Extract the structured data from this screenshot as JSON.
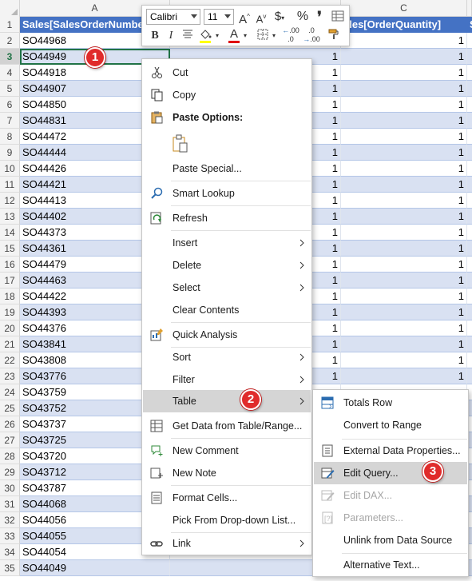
{
  "columns": {
    "a": "A",
    "c": "C"
  },
  "table_header": {
    "col_a": "Sales[SalesOrderNumbe",
    "col_c": "ales[OrderQuantity]",
    "col_d": "S"
  },
  "rows": [
    {
      "n": "1"
    },
    {
      "n": "2",
      "order": "SO44968",
      "b": "",
      "c": "1"
    },
    {
      "n": "3",
      "order": "SO44949",
      "b": "1",
      "c": "1"
    },
    {
      "n": "4",
      "order": "SO44918",
      "b": "1",
      "c": "1"
    },
    {
      "n": "5",
      "order": "SO44907",
      "b": "1",
      "c": "1"
    },
    {
      "n": "6",
      "order": "SO44850",
      "b": "1",
      "c": "1"
    },
    {
      "n": "7",
      "order": "SO44831",
      "b": "1",
      "c": "1"
    },
    {
      "n": "8",
      "order": "SO44472",
      "b": "1",
      "c": "1"
    },
    {
      "n": "9",
      "order": "SO44444",
      "b": "1",
      "c": "1"
    },
    {
      "n": "10",
      "order": "SO44426",
      "b": "1",
      "c": "1"
    },
    {
      "n": "11",
      "order": "SO44421",
      "b": "1",
      "c": "1"
    },
    {
      "n": "12",
      "order": "SO44413",
      "b": "1",
      "c": "1"
    },
    {
      "n": "13",
      "order": "SO44402",
      "b": "1",
      "c": "1"
    },
    {
      "n": "14",
      "order": "SO44373",
      "b": "1",
      "c": "1"
    },
    {
      "n": "15",
      "order": "SO44361",
      "b": "1",
      "c": "1"
    },
    {
      "n": "16",
      "order": "SO44479",
      "b": "1",
      "c": "1"
    },
    {
      "n": "17",
      "order": "SO44463",
      "b": "1",
      "c": "1"
    },
    {
      "n": "18",
      "order": "SO44422",
      "b": "1",
      "c": "1"
    },
    {
      "n": "19",
      "order": "SO44393",
      "b": "1",
      "c": "1"
    },
    {
      "n": "20",
      "order": "SO44376",
      "b": "1",
      "c": "1"
    },
    {
      "n": "21",
      "order": "SO43841",
      "b": "1",
      "c": "1"
    },
    {
      "n": "22",
      "order": "SO43808",
      "b": "1",
      "c": "1"
    },
    {
      "n": "23",
      "order": "SO43776",
      "b": "1",
      "c": "1"
    },
    {
      "n": "24",
      "order": "SO43759",
      "b": "",
      "c": ""
    },
    {
      "n": "25",
      "order": "SO43752",
      "b": "",
      "c": ""
    },
    {
      "n": "26",
      "order": "SO43737",
      "b": "",
      "c": ""
    },
    {
      "n": "27",
      "order": "SO43725",
      "b": "",
      "c": ""
    },
    {
      "n": "28",
      "order": "SO43720",
      "b": "",
      "c": ""
    },
    {
      "n": "29",
      "order": "SO43712",
      "b": "",
      "c": ""
    },
    {
      "n": "30",
      "order": "SO43787",
      "b": "",
      "c": ""
    },
    {
      "n": "31",
      "order": "SO44068",
      "b": "",
      "c": ""
    },
    {
      "n": "32",
      "order": "SO44056",
      "b": "",
      "c": ""
    },
    {
      "n": "33",
      "order": "SO44055",
      "b": "",
      "c": ""
    },
    {
      "n": "34",
      "order": "SO44054",
      "b": "",
      "c": ""
    },
    {
      "n": "35",
      "order": "SO44049",
      "b": "",
      "c": ""
    }
  ],
  "mini_toolbar": {
    "font_name": "Calibri",
    "font_size": "11",
    "grow": "A",
    "shrink": "A",
    "currency": "$",
    "percent": "%",
    "comma": "❜",
    "bold": "B",
    "italic": "I",
    "font_color_letter": "A",
    "decrease_decimal": ".00",
    "increase_decimal": ".0",
    "fill_color": "#ffff00",
    "font_color": "#e00000"
  },
  "context_menu": {
    "cut": "Cut",
    "copy": "Copy",
    "paste_options": "Paste Options:",
    "paste_special": "Paste Special...",
    "smart_lookup": "Smart Lookup",
    "refresh": "Refresh",
    "insert": "Insert",
    "delete": "Delete",
    "select": "Select",
    "clear_contents": "Clear Contents",
    "quick_analysis": "Quick Analysis",
    "sort": "Sort",
    "filter": "Filter",
    "table": "Table",
    "get_data": "Get Data from Table/Range...",
    "new_comment": "New Comment",
    "new_note": "New Note",
    "format_cells": "Format Cells...",
    "pick_list": "Pick From Drop-down List...",
    "link": "Link"
  },
  "table_submenu": {
    "totals_row": "Totals Row",
    "convert_to_range": "Convert to Range",
    "external_data_properties": "External Data Properties...",
    "edit_query": "Edit Query...",
    "edit_dax": "Edit DAX...",
    "parameters": "Parameters...",
    "unlink": "Unlink from Data Source",
    "alternative_text": "Alternative Text..."
  },
  "badges": {
    "one": "1",
    "two": "2",
    "three": "3"
  },
  "colors": {
    "table_header": "#4472c4",
    "band": "#d9e1f2",
    "badge": "#e02b2b",
    "highlight": "#d5d5d5"
  }
}
